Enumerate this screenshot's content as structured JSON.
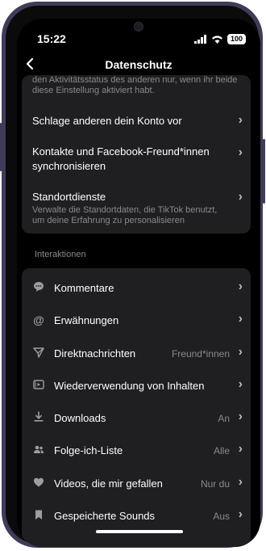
{
  "status": {
    "time": "15:22",
    "battery": "100"
  },
  "nav": {
    "title": "Datenschutz",
    "back_icon": "chevron-left-icon"
  },
  "privacy": {
    "clipped_text": "den Aktivitätsstatus des anderen nur, wenn ihr beide diese Einstellung aktiviert habt.",
    "rows": [
      {
        "title": "Schlage anderen dein Konto vor"
      },
      {
        "title": "Kontakte und Facebook-Freund*innen synchronisieren"
      },
      {
        "title": "Standortdienste",
        "desc": "Verwalte die Standortdaten, die TikTok benutzt, um deine Erfahrung zu personalisieren"
      }
    ]
  },
  "interactions": {
    "label": "Interaktionen",
    "items": [
      {
        "label": "Kommentare",
        "icon": "comment-icon",
        "value": ""
      },
      {
        "label": "Erwähnungen",
        "icon": "at-icon",
        "value": ""
      },
      {
        "label": "Direktnachrichten",
        "icon": "send-icon",
        "value": "Freund*innen"
      },
      {
        "label": "Wiederverwendung von Inhalten",
        "icon": "reuse-video-icon",
        "value": ""
      },
      {
        "label": "Downloads",
        "icon": "download-icon",
        "value": "An"
      },
      {
        "label": "Folge-ich-Liste",
        "icon": "people-icon",
        "value": "Alle"
      },
      {
        "label": "Videos, die mir gefallen",
        "icon": "heart-icon",
        "value": "Nur du"
      },
      {
        "label": "Gespeicherte Sounds",
        "icon": "bookmark-icon",
        "value": "Aus"
      }
    ]
  }
}
